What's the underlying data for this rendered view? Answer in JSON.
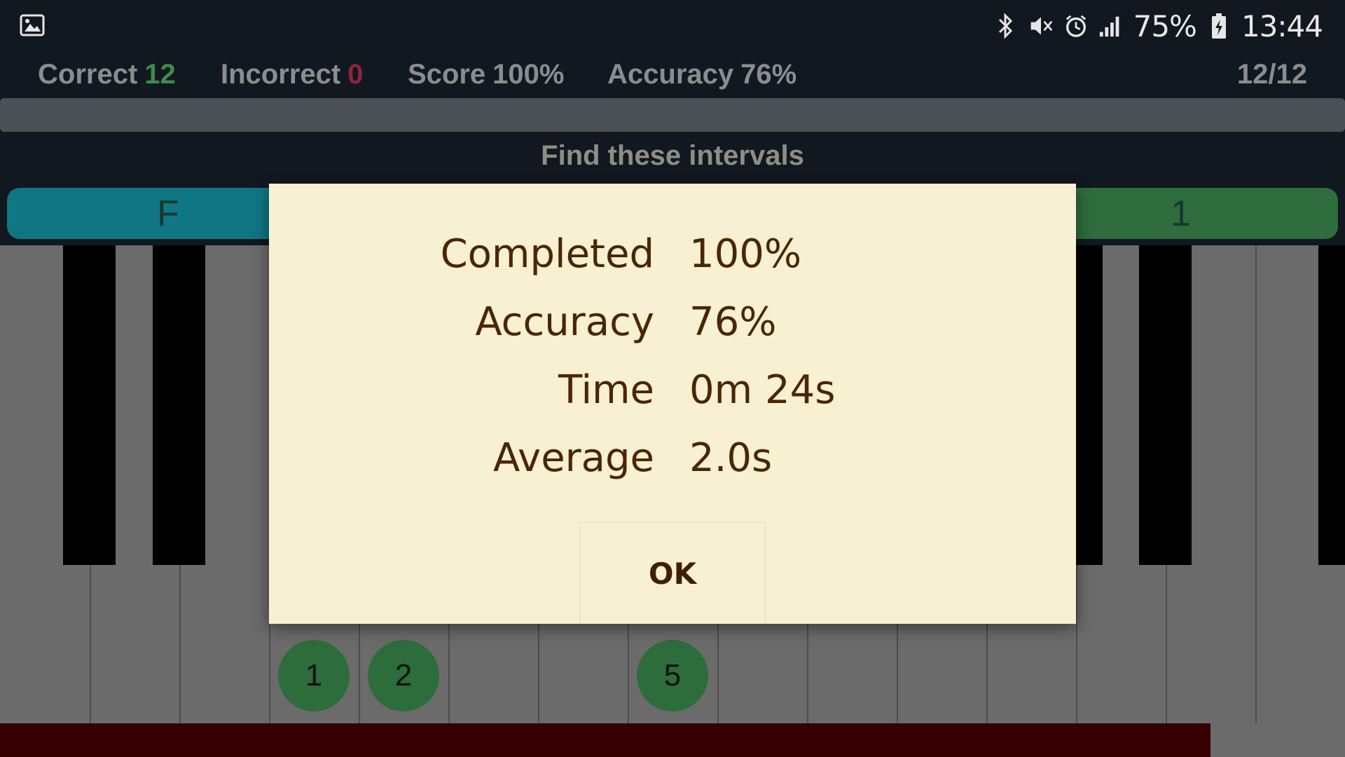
{
  "status_bar": {
    "battery": "75%",
    "time": "13:44",
    "icons": [
      "gallery-icon",
      "bluetooth-icon",
      "mute-icon",
      "alarm-icon",
      "signal-icon",
      "battery-icon"
    ]
  },
  "stats": {
    "correct_label": "Correct",
    "correct_value": "12",
    "incorrect_label": "Incorrect",
    "incorrect_value": "0",
    "score_label": "Score",
    "score_value": "100%",
    "accuracy_label": "Accuracy",
    "accuracy_value": "76%",
    "progress_count": "12/12"
  },
  "prompt": "Find these intervals",
  "pills": {
    "left": "F",
    "right": "1"
  },
  "key_markers": [
    "1",
    "2",
    "5"
  ],
  "bottom_progress_fraction": 0.9,
  "dialog": {
    "rows": [
      {
        "label": "Completed",
        "value": "100%"
      },
      {
        "label": "Accuracy",
        "value": "76%"
      },
      {
        "label": "Time",
        "value": "0m 24s"
      },
      {
        "label": "Average",
        "value": "2.0s"
      }
    ],
    "ok_label": "OK"
  },
  "colors": {
    "background": "#121820",
    "correct_green": "#3f8a4e",
    "incorrect_red": "#8c2440",
    "dialog_bg": "#f7f0d3",
    "dialog_text": "#4a2604",
    "pill_teal": "#107684",
    "pill_green": "#2f6c3e",
    "marker_green": "#2d6c3b",
    "bottom_bar": "#360000"
  }
}
